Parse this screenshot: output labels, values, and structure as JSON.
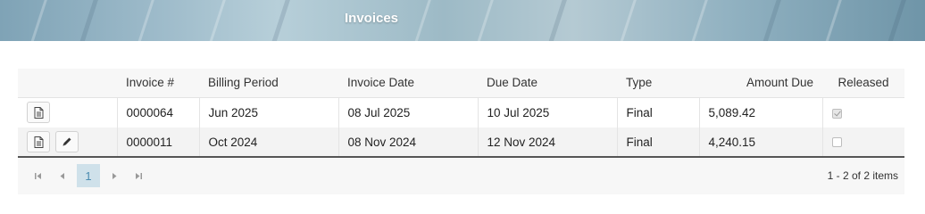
{
  "banner": {
    "title": "Invoices"
  },
  "grid": {
    "columns": {
      "invoice_no": "Invoice #",
      "billing_period": "Billing Period",
      "invoice_date": "Invoice Date",
      "due_date": "Due Date",
      "type": "Type",
      "amount_due": "Amount Due",
      "released": "Released"
    },
    "rows": [
      {
        "invoice_no": "0000064",
        "billing_period": "Jun 2025",
        "invoice_date": "08 Jul 2025",
        "due_date": "10 Jul 2025",
        "type": "Final",
        "amount_due": "5,089.42",
        "released": true,
        "actions": [
          "document-icon"
        ]
      },
      {
        "invoice_no": "0000011",
        "billing_period": "Oct 2024",
        "invoice_date": "08 Nov 2024",
        "due_date": "12 Nov 2024",
        "type": "Final",
        "amount_due": "4,240.15",
        "released": false,
        "actions": [
          "document-icon",
          "pencil-icon"
        ]
      }
    ]
  },
  "pager": {
    "current_page": "1",
    "info": "1 - 2 of 2 items"
  }
}
